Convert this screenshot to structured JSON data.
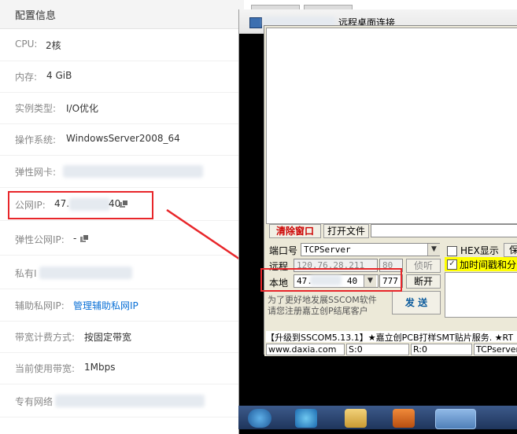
{
  "panel": {
    "header": "配置信息",
    "rows": [
      {
        "label": "CPU:",
        "value": "2核"
      },
      {
        "label": "内存:",
        "value": "4 GiB"
      },
      {
        "label": "实例类型:",
        "value": "I/O优化"
      },
      {
        "label": "操作系统:",
        "value": "WindowsServer2008_64"
      },
      {
        "label": "弹性网卡:",
        "value": ""
      },
      {
        "label": "公网IP:",
        "value": "47.",
        "value_tail": "40"
      },
      {
        "label": "弹性公网IP:",
        "value": "-"
      },
      {
        "label": "私有I",
        "value": ""
      },
      {
        "label": "辅助私网IP:",
        "value": "管理辅助私网IP"
      },
      {
        "label": "带宽计费方式:",
        "value": "按固定带宽"
      },
      {
        "label": "当前使用带宽:",
        "value": "1Mbps"
      },
      {
        "label": "专有网络",
        "value": ""
      }
    ]
  },
  "rdp": {
    "title": "远程桌面连接"
  },
  "app": {
    "clear_button": "清除窗口",
    "open_file_button": "打开文件",
    "port_label": "端口号",
    "port_value": "TCPServer",
    "hex_label": "HEX显示",
    "save_partial": "保",
    "remote_label": "远程",
    "remote_ip": "120.76.28.211",
    "remote_port": "80",
    "listen_button": "侦听",
    "timestamp_label": "加时间戳和分",
    "local_label": "本地",
    "local_ip_start": "47.",
    "local_ip_end": "40",
    "local_port": "777",
    "disconnect_button": "断开",
    "promo_line1": "为了更好地发展SSCOM软件",
    "promo_line2": "请您注册嘉立创P结尾客户",
    "send_button": "发 送",
    "ad_text": "【升级到SSCOM5.13.1】★嘉立创PCB打样SMT贴片服务. ★RT",
    "status": {
      "site": "www.daxia.com",
      "sent": "S:0",
      "recv": "R:0",
      "mode": "TCPserver"
    }
  },
  "colors": {
    "highlight": "#e8262a",
    "link": "#0a70d6"
  }
}
